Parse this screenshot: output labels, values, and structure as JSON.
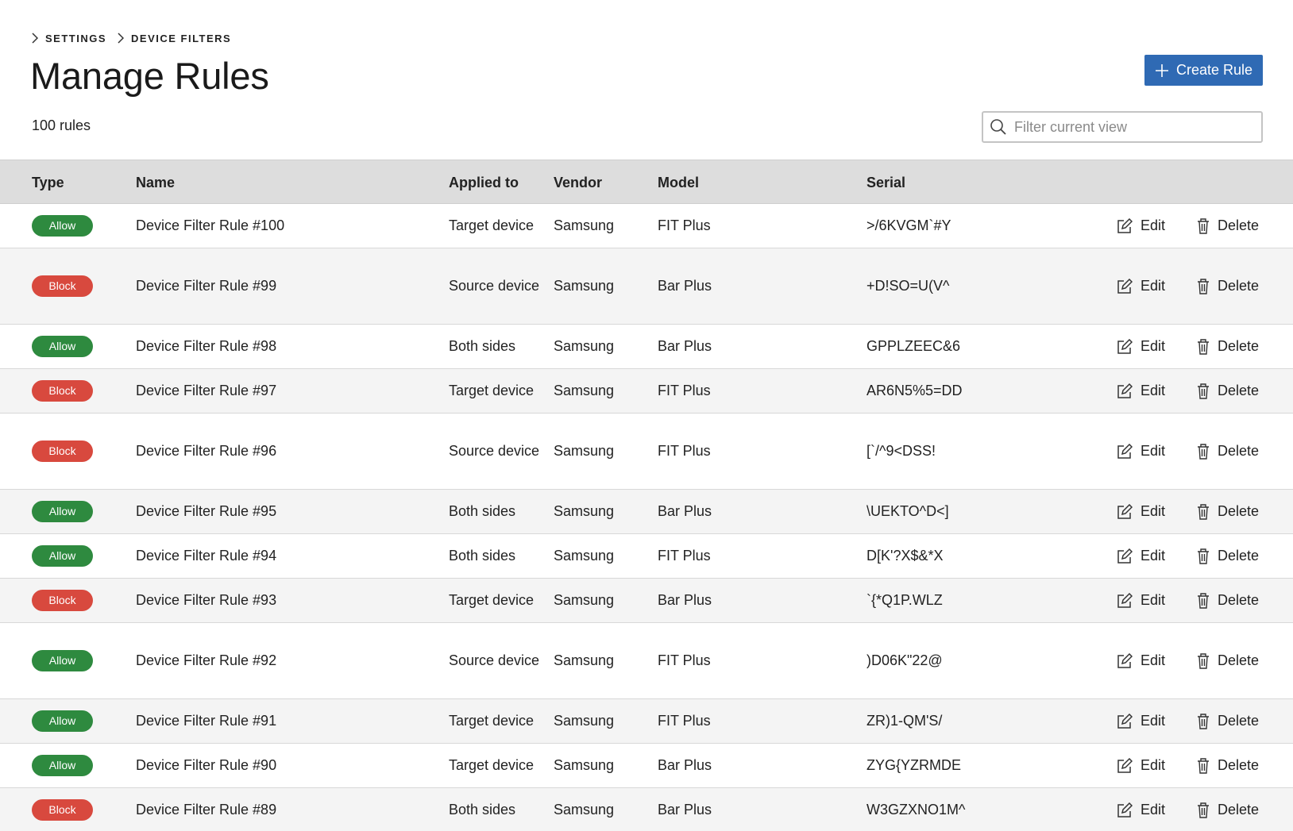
{
  "breadcrumb": [
    {
      "label": "SETTINGS"
    },
    {
      "label": "DEVICE FILTERS"
    }
  ],
  "page": {
    "title": "Manage Rules",
    "count": "100 rules"
  },
  "toolbar": {
    "create_label": "Create Rule",
    "filter_placeholder": "Filter current view"
  },
  "table": {
    "columns": {
      "type": "Type",
      "name": "Name",
      "applied": "Applied to",
      "vendor": "Vendor",
      "model": "Model",
      "serial": "Serial"
    },
    "actions": {
      "edit": "Edit",
      "delete": "Delete"
    },
    "rows": [
      {
        "type": "Allow",
        "name": "Device Filter Rule #100",
        "applied": "Target device",
        "vendor": "Samsung",
        "model": "FIT Plus",
        "serial": ">/6KVGM`#Y"
      },
      {
        "type": "Block",
        "name": "Device Filter Rule #99",
        "applied": "Source device",
        "vendor": "Samsung",
        "model": "Bar Plus",
        "serial": "+D!SO=U(V^"
      },
      {
        "type": "Allow",
        "name": "Device Filter Rule #98",
        "applied": "Both sides",
        "vendor": "Samsung",
        "model": "Bar Plus",
        "serial": "GPPLZEEC&6"
      },
      {
        "type": "Block",
        "name": "Device Filter Rule #97",
        "applied": "Target device",
        "vendor": "Samsung",
        "model": "FIT Plus",
        "serial": "AR6N5%5=DD"
      },
      {
        "type": "Block",
        "name": "Device Filter Rule #96",
        "applied": "Source device",
        "vendor": "Samsung",
        "model": "FIT Plus",
        "serial": "[`/^9<DSS!"
      },
      {
        "type": "Allow",
        "name": "Device Filter Rule #95",
        "applied": "Both sides",
        "vendor": "Samsung",
        "model": "Bar Plus",
        "serial": "\\UEKTO^D<]"
      },
      {
        "type": "Allow",
        "name": "Device Filter Rule #94",
        "applied": "Both sides",
        "vendor": "Samsung",
        "model": "FIT Plus",
        "serial": "D[K'?X$&*X"
      },
      {
        "type": "Block",
        "name": "Device Filter Rule #93",
        "applied": "Target device",
        "vendor": "Samsung",
        "model": "Bar Plus",
        "serial": "`{*Q1P.WLZ"
      },
      {
        "type": "Allow",
        "name": "Device Filter Rule #92",
        "applied": "Source device",
        "vendor": "Samsung",
        "model": "FIT Plus",
        "serial": ")D06K\"22@"
      },
      {
        "type": "Allow",
        "name": "Device Filter Rule #91",
        "applied": "Target device",
        "vendor": "Samsung",
        "model": "FIT Plus",
        "serial": "ZR)1-QM'S/"
      },
      {
        "type": "Allow",
        "name": "Device Filter Rule #90",
        "applied": "Target device",
        "vendor": "Samsung",
        "model": "Bar Plus",
        "serial": "ZYG{YZRMDE"
      },
      {
        "type": "Block",
        "name": "Device Filter Rule #89",
        "applied": "Both sides",
        "vendor": "Samsung",
        "model": "Bar Plus",
        "serial": "W3GZXNO1M^"
      }
    ]
  },
  "colors": {
    "primary": "#2f6ab4",
    "allow": "#2e8a3f",
    "block": "#d8493e",
    "header_bg": "#dddddd",
    "row_alt_bg": "#f4f4f4"
  },
  "icons": {
    "breadcrumb_separator": "chevron-right-icon",
    "create": "plus-icon",
    "filter": "search-icon",
    "edit": "edit-icon",
    "delete": "trash-icon"
  }
}
